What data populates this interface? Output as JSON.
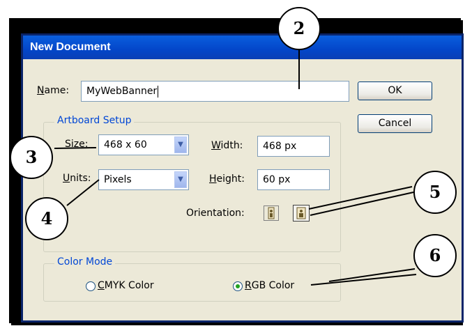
{
  "dialog": {
    "title": "New Document",
    "name_label_accel": "N",
    "name_label_rest": "ame:",
    "name_value": "MyWebBanner",
    "ok_label": "OK",
    "cancel_label": "Cancel"
  },
  "artboard": {
    "legend": "Artboard Setup",
    "size_label_accel": "S",
    "size_label_rest": "ize:",
    "size_value": "468 x 60",
    "units_label_accel": "U",
    "units_label_rest": "nits:",
    "units_value": "Pixels",
    "width_label_accel": "W",
    "width_label_rest": "idth:",
    "width_value": "468 px",
    "height_label_accel": "H",
    "height_label_rest": "eight:",
    "height_value": "60 px",
    "orientation_label": "Orientation:"
  },
  "color_mode": {
    "legend": "Color Mode",
    "cmyk_accel": "C",
    "cmyk_rest": "MYK Color",
    "rgb_accel": "R",
    "rgb_rest": "GB Color",
    "selected": "RGB"
  },
  "callouts": [
    "2",
    "3",
    "4",
    "5",
    "6"
  ],
  "colors": {
    "titlebar": "#0a5fde",
    "dialog_bg": "#ece9d8",
    "group_label": "#0046d5",
    "radio_selected": "#21a121"
  }
}
